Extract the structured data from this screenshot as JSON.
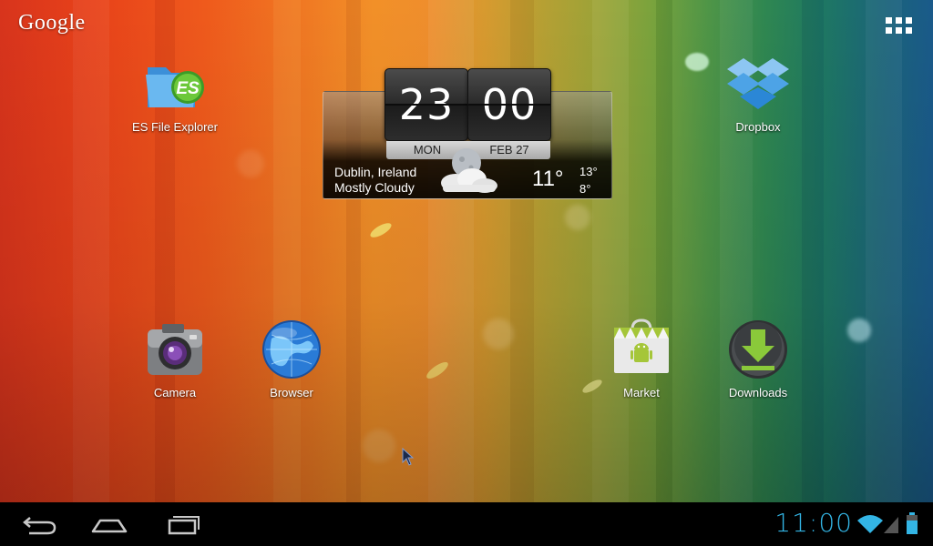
{
  "launcher": {
    "search_label": "Google",
    "apps_button": "apps-grid-icon"
  },
  "widget": {
    "hour": "23",
    "minute": "00",
    "day": "MON",
    "date": "FEB 27",
    "city": "Dublin, Ireland",
    "condition": "Mostly Cloudy",
    "temperature": "11°",
    "high": "13°",
    "low": "8°",
    "weather_icon": "cloudy-moon-icon"
  },
  "apps": {
    "es_file_explorer": {
      "label": "ES File Explorer",
      "icon": "es-file-explorer-icon"
    },
    "dropbox": {
      "label": "Dropbox",
      "icon": "dropbox-icon"
    },
    "camera": {
      "label": "Camera",
      "icon": "camera-icon"
    },
    "browser": {
      "label": "Browser",
      "icon": "globe-icon"
    },
    "market": {
      "label": "Market",
      "icon": "market-bag-icon"
    },
    "downloads": {
      "label": "Downloads",
      "icon": "download-icon"
    }
  },
  "navbar": {
    "back": "back-icon",
    "home": "home-icon",
    "recents": "recent-apps-icon",
    "time": "11:00",
    "wifi": "wifi-icon",
    "signal": "signal-icon",
    "battery": "battery-icon"
  },
  "colors": {
    "accent": "#33b5e5",
    "navbar": "#000000"
  }
}
